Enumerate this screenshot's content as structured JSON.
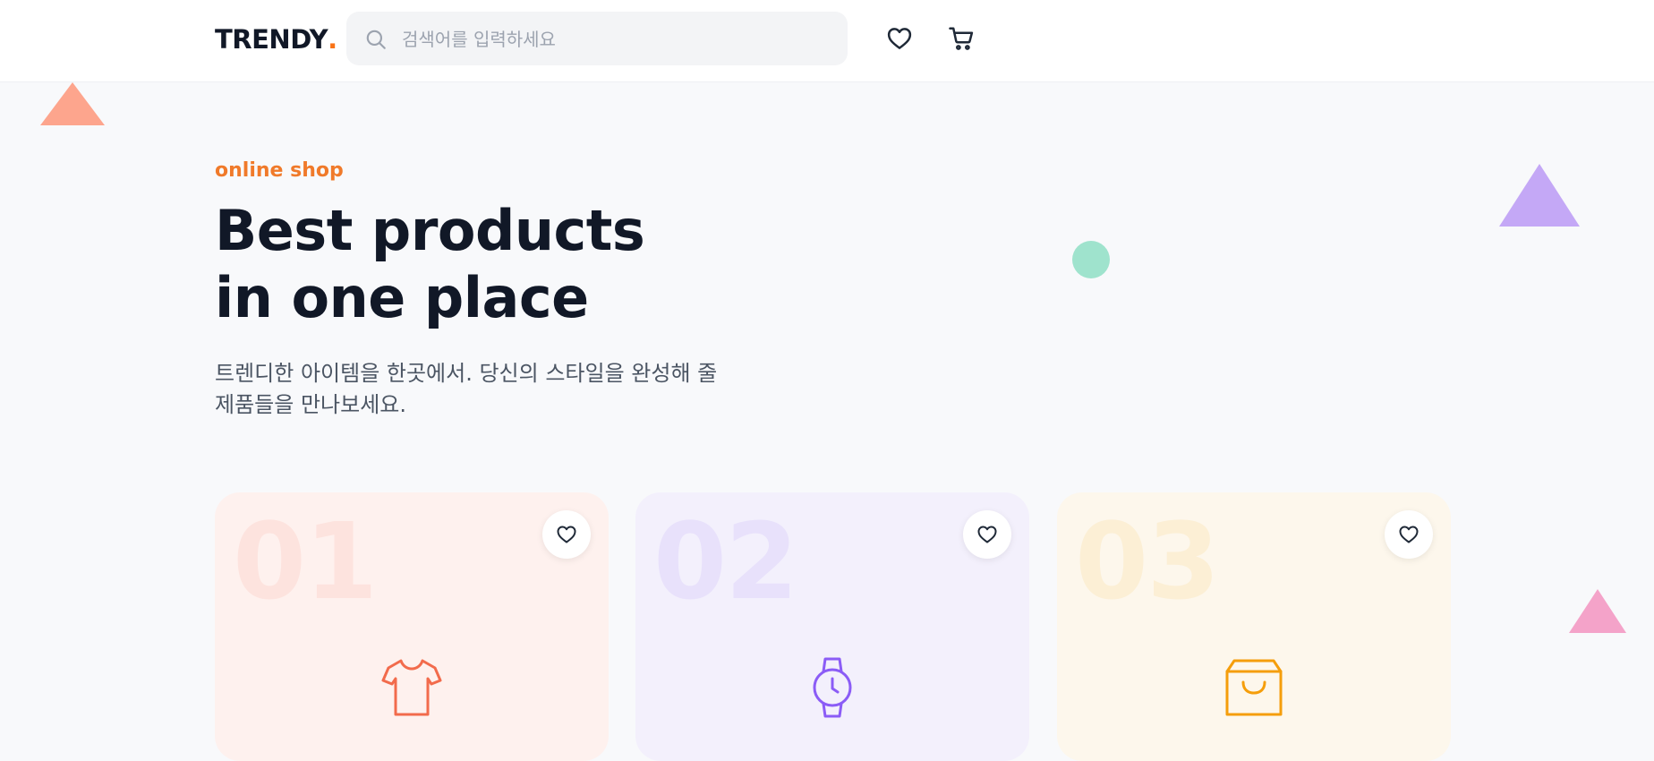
{
  "header": {
    "logo_text": "TRENDY",
    "logo_dot": ".",
    "search_placeholder": "검색어를 입력하세요"
  },
  "hero": {
    "eyebrow": "online shop",
    "title_line1": "Best products",
    "title_line2": "in one place",
    "subtitle_line1": "트렌디한 아이템을 한곳에서. 당신의 스타일을 완성해 줄",
    "subtitle_line2": "제품들을 만나보세요."
  },
  "cards": [
    {
      "number": "01",
      "icon": "tshirt-icon",
      "color": "#f26b4c"
    },
    {
      "number": "02",
      "icon": "watch-icon",
      "color": "#8b5cf6"
    },
    {
      "number": "03",
      "icon": "shopping-bag-icon",
      "color": "#f59e0b"
    }
  ],
  "colors": {
    "accent": "#f07a2a",
    "background": "#f8f9fb",
    "text": "#111827"
  }
}
